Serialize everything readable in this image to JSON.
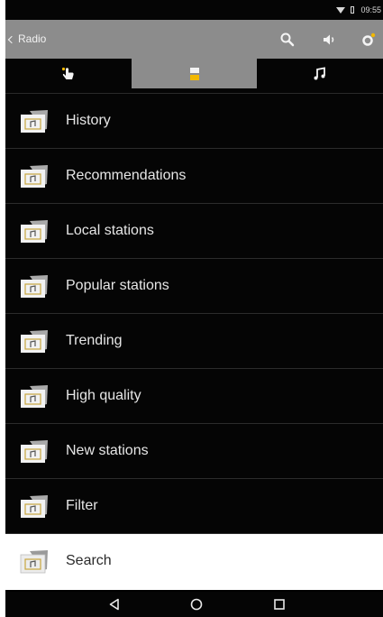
{
  "status_bar": {
    "time": "09:55"
  },
  "app_bar": {
    "back_label": "Radio",
    "icons": [
      "search-icon",
      "volume-icon",
      "settings-icon"
    ]
  },
  "tabs": [
    {
      "icon": "hand-pointer-icon",
      "active": false
    },
    {
      "icon": "list-icon",
      "active": true
    },
    {
      "icon": "music-note-icon",
      "active": false
    }
  ],
  "list": {
    "items": [
      {
        "label": "History",
        "icon": "radio-folder-icon"
      },
      {
        "label": "Recommendations",
        "icon": "radio-folder-icon"
      },
      {
        "label": "Local stations",
        "icon": "radio-folder-icon"
      },
      {
        "label": "Popular stations",
        "icon": "radio-folder-icon"
      },
      {
        "label": "Trending",
        "icon": "radio-folder-icon"
      },
      {
        "label": "High quality",
        "icon": "radio-folder-icon"
      },
      {
        "label": "New stations",
        "icon": "radio-folder-icon"
      },
      {
        "label": "Filter",
        "icon": "radio-folder-icon"
      },
      {
        "label": "Search",
        "icon": "radio-folder-icon",
        "selected": true
      }
    ]
  },
  "nav_bar": {
    "icons": [
      "back-triangle-icon",
      "home-circle-icon",
      "recents-square-icon"
    ]
  },
  "colors": {
    "bar_gray": "#8c8c8c",
    "background": "#050505",
    "text": "#e6e6e6"
  }
}
